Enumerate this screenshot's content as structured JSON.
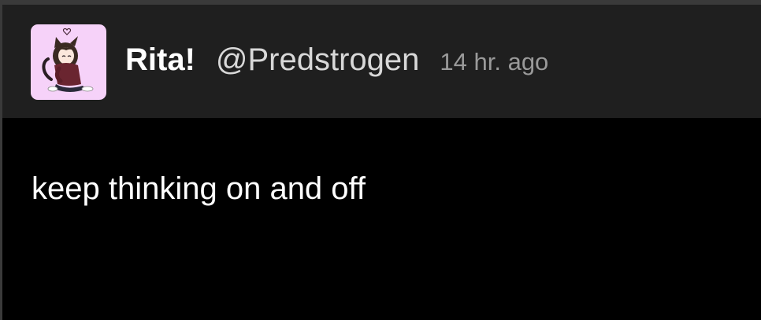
{
  "post": {
    "author": {
      "display_name": "Rita!",
      "handle": "@Predstrogen",
      "avatar_icon": "cat-girl-avatar-icon",
      "avatar_background": "#f6d2f9"
    },
    "timestamp": "14 hr. ago",
    "body_text": "keep thinking on and off"
  },
  "colors": {
    "header_background": "#1f1f1f",
    "page_background": "#000000",
    "border": "#3a3a3a"
  }
}
